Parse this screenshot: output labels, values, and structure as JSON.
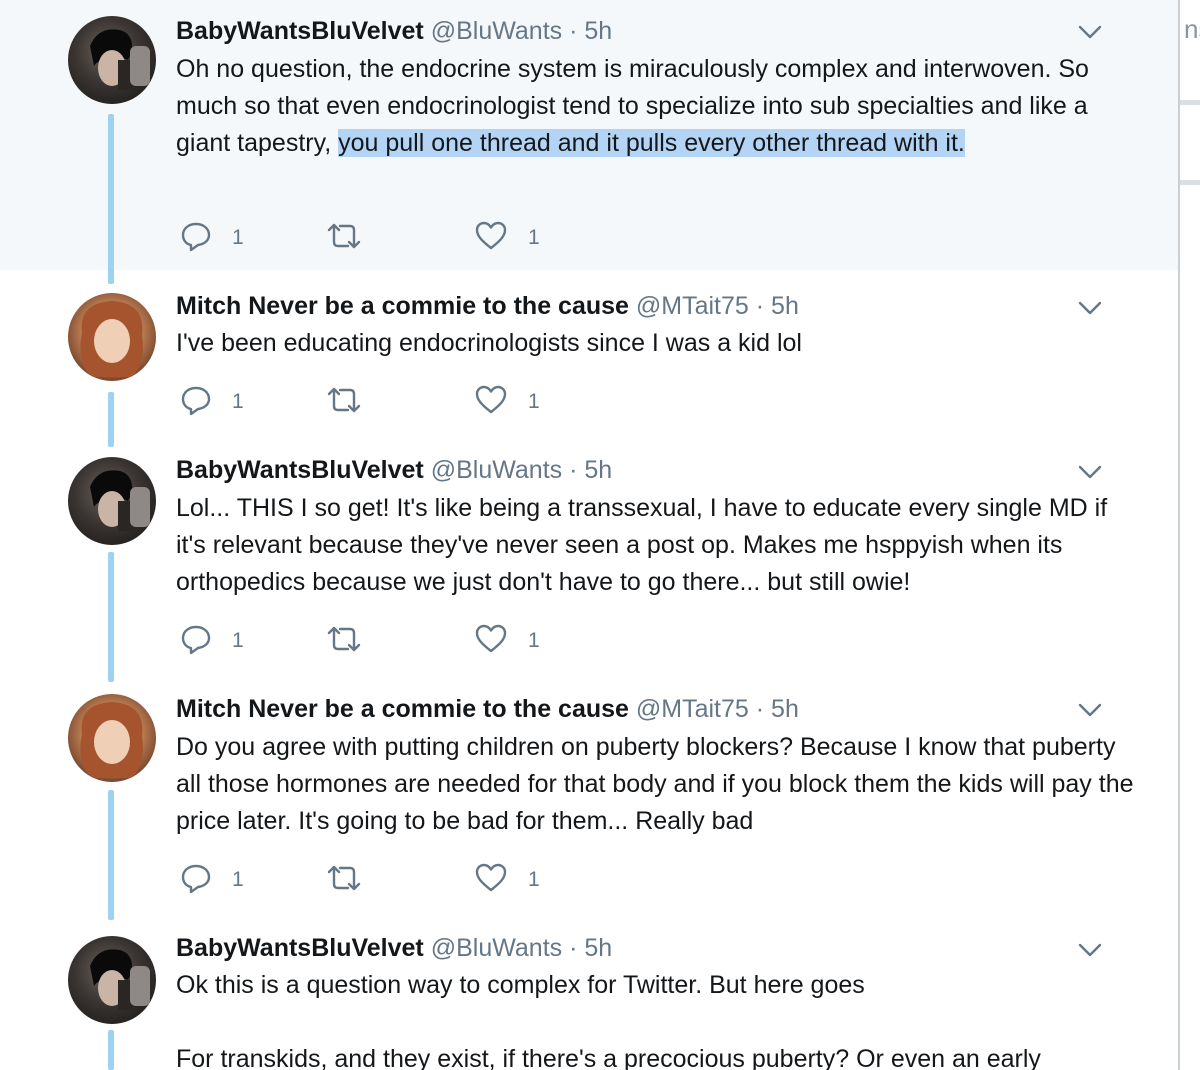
{
  "tweets": [
    {
      "name": "BabyWantsBluVelvet",
      "handle": "@BluWants",
      "dot": "·",
      "time": "5h",
      "text_before": "Oh no question, the endocrine system is miraculously complex and interwoven. So much so that even endocrinologist tend to specialize into sub specialties and like a giant tapestry, ",
      "text_highlighted": "you pull one thread and it pulls every other thread with it.",
      "reply_count": "1",
      "like_count": "1",
      "avatar": "dark-haired-man-avatar"
    },
    {
      "name": "Mitch Never be a commie to the cause",
      "handle": "@MTait75",
      "dot": "·",
      "time": "5h",
      "text_before": "I've been educating endocrinologists since I was a kid lol",
      "text_highlighted": "",
      "reply_count": "1",
      "like_count": "1",
      "avatar": "curly-haired-girl-avatar"
    },
    {
      "name": "BabyWantsBluVelvet",
      "handle": "@BluWants",
      "dot": "·",
      "time": "5h",
      "text_before": "Lol... THIS I so get! It's like being a transsexual, I have to educate every single MD if it's relevant because they've never seen a post op. Makes me hsppyish when its orthopedics because we just don't have to go there... but still owie!",
      "text_highlighted": "",
      "reply_count": "1",
      "like_count": "1",
      "avatar": "dark-haired-man-avatar"
    },
    {
      "name": "Mitch Never be a commie to the cause",
      "handle": "@MTait75",
      "dot": "·",
      "time": "5h",
      "text_before": "Do you agree with putting children on puberty blockers? Because I know that puberty all those hormones are needed for that body and if you block them the kids will pay the price later. It's going to be bad for them... Really bad",
      "text_highlighted": "",
      "reply_count": "1",
      "like_count": "1",
      "avatar": "curly-haired-girl-avatar"
    },
    {
      "name": "BabyWantsBluVelvet",
      "handle": "@BluWants",
      "dot": "·",
      "time": "5h",
      "text_before": "Ok this is a question way to complex for Twitter. But here goes",
      "text_second": "For transkids, and they exist, if there's a precocious puberty? Or even an early",
      "avatar": "dark-haired-man-avatar"
    }
  ],
  "edge_text": "ns",
  "icons": {
    "reply": "reply-icon",
    "retweet": "retweet-icon",
    "like": "heart-icon",
    "more": "chevron-down-icon"
  },
  "colors": {
    "highlight_row": "#f5f8fa",
    "thread_line": "#9fd1f3",
    "selection": "#b3d4f5",
    "secondary_text": "#657786"
  }
}
